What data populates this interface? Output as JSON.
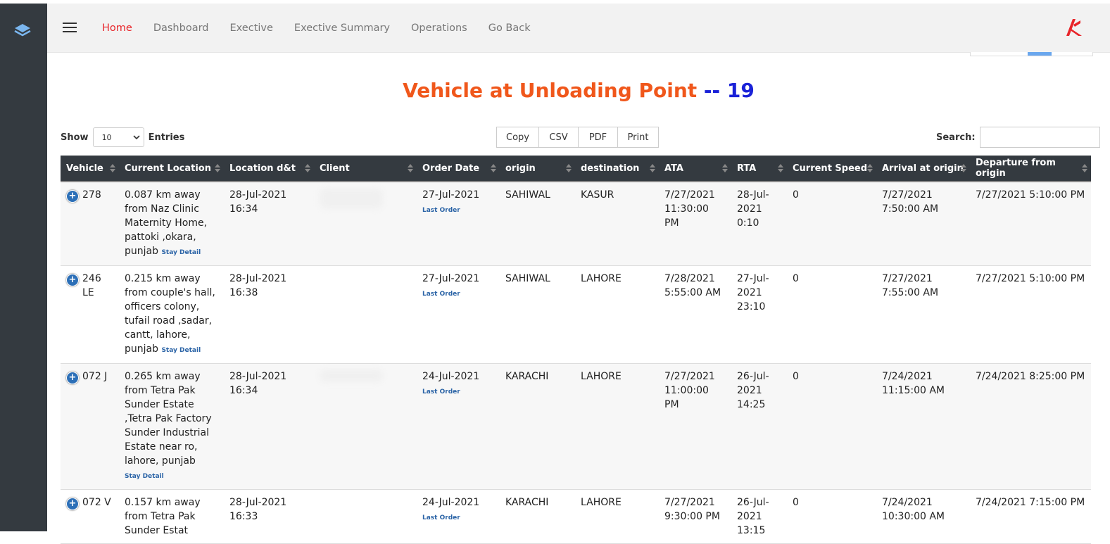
{
  "nav": {
    "items": [
      "Home",
      "Dashboard",
      "Exective",
      "Exective Summary",
      "Operations",
      "Go Back"
    ],
    "active": "Home"
  },
  "page": {
    "title": "Vehicle at Unloading Point",
    "count_text": "-- 19"
  },
  "controls": {
    "show_label": "Show",
    "entries_value": "10",
    "entries_label": "Entries",
    "buttons": [
      "Copy",
      "CSV",
      "PDF",
      "Print"
    ],
    "search_label": "Search:",
    "search_value": ""
  },
  "table": {
    "columns": [
      "Vehicle",
      "Current Location",
      "Location d&t",
      "Client",
      "Order Date",
      "origin",
      "destination",
      "ATA",
      "RTA",
      "Current Speed",
      "Arrival at origin",
      "Departure from origin"
    ],
    "rows": [
      {
        "vehicle": "278",
        "location": "0.087 km away from Naz Clinic Maternity Home, pattoki ,okara, punjab",
        "stay_link": "Stay Detail",
        "loc_dt": "28-Jul-2021 16:34",
        "order_date": "27-Jul-2021",
        "last_order": "Last Order",
        "origin": "SAHIWAL",
        "destination": "KASUR",
        "ata": "7/27/2021 11:30:00 PM",
        "rta": "28-Jul-2021 0:10",
        "speed": "0",
        "arrival": "7/27/2021 7:50:00 AM",
        "departure": "7/27/2021 5:10:00 PM"
      },
      {
        "vehicle": "246 LE",
        "location": "0.215 km away from couple's hall, officers colony, tufail road ,sadar, cantt, lahore, punjab",
        "stay_link": "Stay Detail",
        "loc_dt": "28-Jul-2021 16:38",
        "order_date": "27-Jul-2021",
        "last_order": "Last Order",
        "origin": "SAHIWAL",
        "destination": "LAHORE",
        "ata": "7/28/2021 5:55:00 AM",
        "rta": "27-Jul-2021 23:10",
        "speed": "0",
        "arrival": "7/27/2021 7:55:00 AM",
        "departure": "7/27/2021 5:10:00 PM"
      },
      {
        "vehicle": "072 J",
        "location": "0.265 km away from Tetra Pak Sunder Estate ,Tetra Pak Factory Sunder Industrial Estate near ro, lahore, punjab",
        "stay_link": "Stay Detail",
        "loc_dt": "28-Jul-2021 16:34",
        "order_date": "24-Jul-2021",
        "last_order": "Last Order",
        "origin": "KARACHI",
        "destination": "LAHORE",
        "ata": "7/27/2021 11:00:00 PM",
        "rta": "26-Jul-2021 14:25",
        "speed": "0",
        "arrival": "7/24/2021 11:15:00 AM",
        "departure": "7/24/2021 8:25:00 PM"
      },
      {
        "vehicle": "072 V",
        "location": "0.157 km away from Tetra Pak Sunder Estat",
        "stay_link": "",
        "loc_dt": "28-Jul-2021 16:33",
        "order_date": "24-Jul-2021",
        "last_order": "Last Order",
        "origin": "KARACHI",
        "destination": "LAHORE",
        "ata": "7/27/2021 9:30:00 PM",
        "rta": "26-Jul-2021 13:15",
        "speed": "0",
        "arrival": "7/24/2021 10:30:00 AM",
        "departure": "7/24/2021 7:15:00 PM"
      }
    ]
  }
}
